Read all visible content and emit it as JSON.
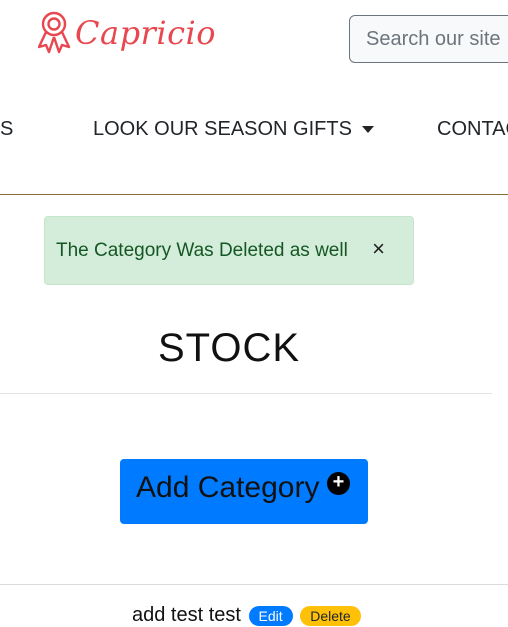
{
  "brand": {
    "name": "Capricio",
    "color": "#e8474f",
    "icon": "ribbon-award-icon"
  },
  "search": {
    "placeholder": "Search our site"
  },
  "nav": {
    "items": [
      {
        "label": "S"
      },
      {
        "label": "LOOK OUR SEASON GIFTS",
        "has_dropdown": true
      },
      {
        "label": "CONTAC"
      }
    ]
  },
  "alert": {
    "message": "The Category Was Deleted as well",
    "close": "×"
  },
  "page": {
    "title": "STOCK"
  },
  "actions": {
    "add_category_label": "Add Category",
    "add_icon": "plus-circle-icon"
  },
  "categories": [
    {
      "name": "add test test",
      "edit_label": "Edit",
      "delete_label": "Delete"
    }
  ],
  "colors": {
    "primary": "#007bff",
    "warning": "#ffc107",
    "success_bg": "#d4edda",
    "success_text": "#155724"
  }
}
